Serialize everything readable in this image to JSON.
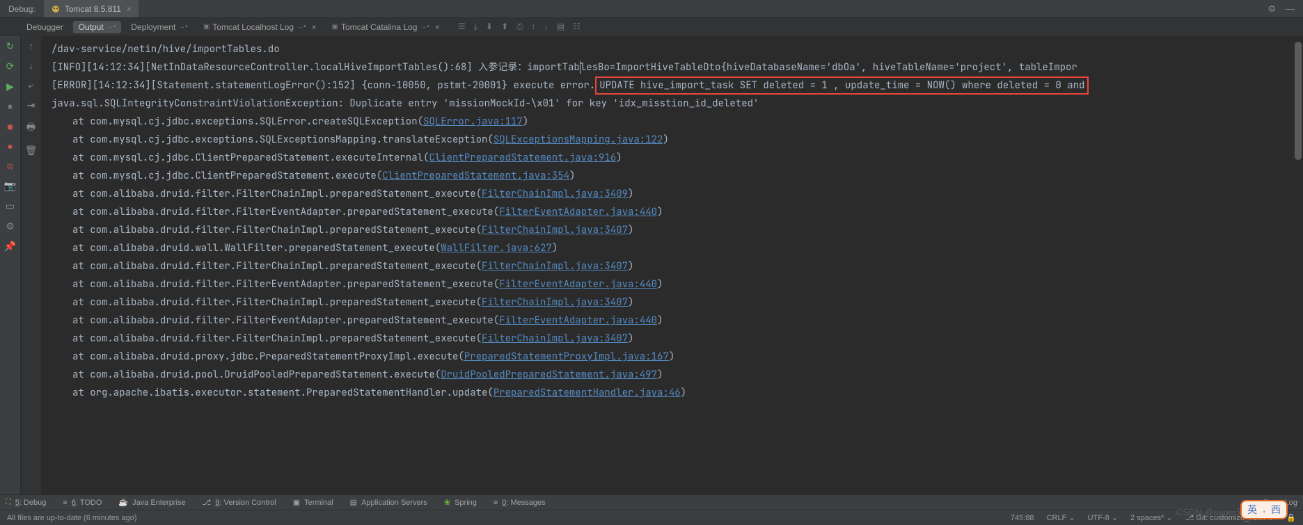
{
  "topTabs": {
    "debug": "Debug:",
    "runConfig": "Tomcat 8.5.811"
  },
  "subTabs": {
    "debugger": "Debugger",
    "output": "Output",
    "deployment": "Deployment",
    "localhostLog": "Tomcat Localhost Log",
    "catalinaLog": "Tomcat Catalina Log"
  },
  "console": {
    "line1": "/dav-service/netin/hive/importTables.do",
    "line2a": "[INFO][14:12:34][NetInDataResourceController.localHiveImportTables():68] 入参记录：importTab",
    "line2b": "lesBo=ImportHiveTableDto{hiveDatabaseName='dbOa', hiveTableName='project', tableImpor",
    "line3a": "[ERROR][14:12:34][Statement.statementLogError():152] {conn-10050, pstmt-20001} execute error.",
    "line3b": " UPDATE hive_import_task SET deleted = 1 , update_time = NOW() where deleted = 0 and ",
    "line4": "java.sql.SQLIntegrityConstraintViolationException: Duplicate entry 'missionMockId-\\x01' for key 'idx_misstion_id_deleted'",
    "stack": [
      {
        "pre": "at com.mysql.cj.jdbc.exceptions.SQLError.createSQLException(",
        "link": "SQLError.java:117",
        "post": ")"
      },
      {
        "pre": "at com.mysql.cj.jdbc.exceptions.SQLExceptionsMapping.translateException(",
        "link": "SQLExceptionsMapping.java:122",
        "post": ")"
      },
      {
        "pre": "at com.mysql.cj.jdbc.ClientPreparedStatement.executeInternal(",
        "link": "ClientPreparedStatement.java:916",
        "post": ")"
      },
      {
        "pre": "at com.mysql.cj.jdbc.ClientPreparedStatement.execute(",
        "link": "ClientPreparedStatement.java:354",
        "post": ")"
      },
      {
        "pre": "at com.alibaba.druid.filter.FilterChainImpl.preparedStatement_execute(",
        "link": "FilterChainImpl.java:3409",
        "post": ")"
      },
      {
        "pre": "at com.alibaba.druid.filter.FilterEventAdapter.preparedStatement_execute(",
        "link": "FilterEventAdapter.java:440",
        "post": ")"
      },
      {
        "pre": "at com.alibaba.druid.filter.FilterChainImpl.preparedStatement_execute(",
        "link": "FilterChainImpl.java:3407",
        "post": ")"
      },
      {
        "pre": "at com.alibaba.druid.wall.WallFilter.preparedStatement_execute(",
        "link": "WallFilter.java:627",
        "post": ")"
      },
      {
        "pre": "at com.alibaba.druid.filter.FilterChainImpl.preparedStatement_execute(",
        "link": "FilterChainImpl.java:3407",
        "post": ")"
      },
      {
        "pre": "at com.alibaba.druid.filter.FilterEventAdapter.preparedStatement_execute(",
        "link": "FilterEventAdapter.java:440",
        "post": ")"
      },
      {
        "pre": "at com.alibaba.druid.filter.FilterChainImpl.preparedStatement_execute(",
        "link": "FilterChainImpl.java:3407",
        "post": ")"
      },
      {
        "pre": "at com.alibaba.druid.filter.FilterEventAdapter.preparedStatement_execute(",
        "link": "FilterEventAdapter.java:440",
        "post": ")"
      },
      {
        "pre": "at com.alibaba.druid.filter.FilterChainImpl.preparedStatement_execute(",
        "link": "FilterChainImpl.java:3407",
        "post": ")"
      },
      {
        "pre": "at com.alibaba.druid.proxy.jdbc.PreparedStatementProxyImpl.execute(",
        "link": "PreparedStatementProxyImpl.java:167",
        "post": ")"
      },
      {
        "pre": "at com.alibaba.druid.pool.DruidPooledPreparedStatement.execute(",
        "link": "DruidPooledPreparedStatement.java:497",
        "post": ")"
      },
      {
        "pre": "at org.apache.ibatis.executor.statement.PreparedStatementHandler.update(",
        "link": "PreparedStatementHandler.java:46",
        "post": ")"
      }
    ]
  },
  "bottom": {
    "debug": "5: Debug",
    "todo": "6: TODO",
    "javaEnterprise": "Java Enterprise",
    "versionControl": "9: Version Control",
    "terminal": "Terminal",
    "appServers": "Application Servers",
    "spring": "Spring",
    "messages": "0: Messages",
    "eventLog": "Event Log"
  },
  "status": {
    "left": "All files are up-to-date (6 minutes ago)",
    "pos": "745:88",
    "crlf": "CRLF",
    "encoding": "UTF-8",
    "spaces": "2 spaces*",
    "git": "Git: customize_netin"
  },
  "watermark": "CSDN @super先生",
  "ime": {
    "a": "英",
    "b": "西"
  }
}
